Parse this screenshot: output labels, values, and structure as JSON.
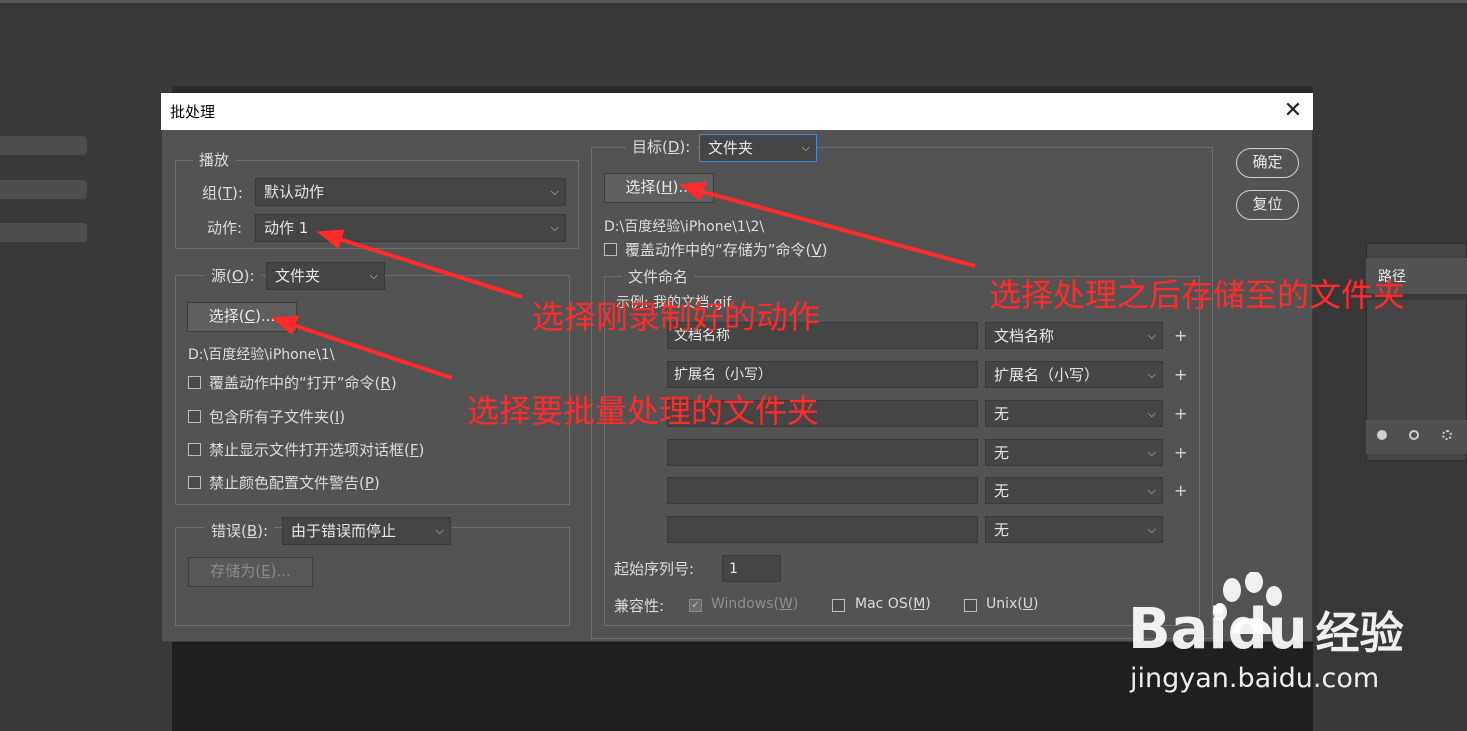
{
  "dialog": {
    "title": "批处理",
    "close": "✕",
    "ok_label": "确定",
    "reset_label": "复位"
  },
  "play": {
    "legend": "播放",
    "group_label": "组(",
    "group_key": "T",
    "group_label_end": "):",
    "group_value": "默认动作",
    "action_label": "动作:",
    "action_value": "动作 1"
  },
  "source": {
    "legend": "源(",
    "legend_key": "O",
    "legend_end": "):",
    "value": "文件夹",
    "choose_label": "选择(",
    "choose_key": "C",
    "choose_end": ")...",
    "path": "D:\\百度经验\\iPhone\\1\\",
    "options": [
      {
        "text": "覆盖动作中的“打开”命令(",
        "key": "R",
        "end": ")"
      },
      {
        "text": "包含所有子文件夹(",
        "key": "I",
        "end": ")"
      },
      {
        "text": "禁止显示文件打开选项对话框(",
        "key": "F",
        "end": ")"
      },
      {
        "text": "禁止颜色配置文件警告(",
        "key": "P",
        "end": ")"
      }
    ]
  },
  "error": {
    "label": "错误(",
    "key": "B",
    "end": "):",
    "value": "由于错误而停止",
    "saveas_label": "存储为(",
    "saveas_key": "E",
    "saveas_end": ")..."
  },
  "target": {
    "label": "目标(",
    "key": "D",
    "end": "):",
    "value": "文件夹",
    "choose_label": "选择(",
    "choose_key": "H",
    "choose_end": ")...",
    "path": "D:\\百度经验\\iPhone\\1\\2\\",
    "override_text": "覆盖动作中的“存储为”命令(",
    "override_key": "V",
    "override_end": ")"
  },
  "naming": {
    "legend": "文件命名",
    "example": "示例: 我的文档.gif",
    "rows": [
      {
        "field": "文档名称",
        "select": "文档名称",
        "plus": "+"
      },
      {
        "field": "扩展名（小写）",
        "select": "扩展名（小写）",
        "plus": "+"
      },
      {
        "field": "",
        "select": "无",
        "plus": "+"
      },
      {
        "field": "",
        "select": "无",
        "plus": "+"
      },
      {
        "field": "",
        "select": "无",
        "plus": "+"
      },
      {
        "field": "",
        "select": "无",
        "plus": ""
      }
    ],
    "serial_label": "起始序列号:",
    "serial_value": "1",
    "compat_label": "兼容性:",
    "windows": "Windows(",
    "windows_key": "W",
    "windows_end": ")",
    "macos": "Mac OS(",
    "macos_key": "M",
    "macos_end": ")",
    "unix": "Unix(",
    "unix_key": "U",
    "unix_end": ")"
  },
  "annotations": {
    "a1": "选择刚录制好的动作",
    "a2": "选择要批量处理的文件夹",
    "a3": "选择处理之后存储至的文件夹",
    "color": "#ff2a2a"
  },
  "background_panel": {
    "tab_label": "路径"
  },
  "watermark": {
    "brand": "Bai",
    "brand_tail": "du",
    "brand_cn": "经验",
    "url": "jingyan.baidu.com"
  }
}
